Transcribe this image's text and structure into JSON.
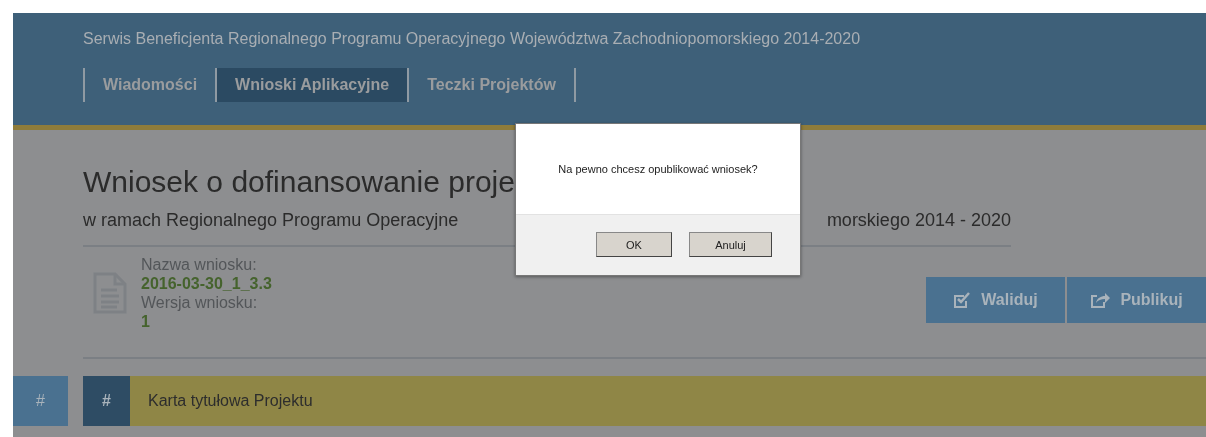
{
  "header": {
    "title": "Serwis Beneficjenta Regionalnego Programu Operacyjnego Województwa Zachodniopomorskiego 2014-2020"
  },
  "tabs": [
    {
      "label": "Wiadomości",
      "selected": false
    },
    {
      "label": "Wnioski Aplikacyjne",
      "selected": true
    },
    {
      "label": "Teczki Projektów",
      "selected": false
    }
  ],
  "page": {
    "title": "Wniosek o dofinansowanie proje",
    "subtitle_left": "w ramach Regionalnego Programu Operacyjne",
    "subtitle_right": "morskiego 2014 - 2020"
  },
  "application": {
    "name_label": "Nazwa wniosku:",
    "name": "2016-03-30_1_3.3",
    "version_label": "Wersja wniosku:",
    "version": "1"
  },
  "actions": [
    {
      "kind": "validate",
      "label": "Waliduj"
    },
    {
      "kind": "publish",
      "label": "Publikuj"
    }
  ],
  "section": {
    "outer_marker": "#",
    "marker": "#",
    "title": "Karta tytułowa Projektu"
  },
  "dialog": {
    "message": "Na pewno chcesz opublikować wniosek?",
    "buttons": [
      "OK",
      "Anuluj"
    ]
  }
}
